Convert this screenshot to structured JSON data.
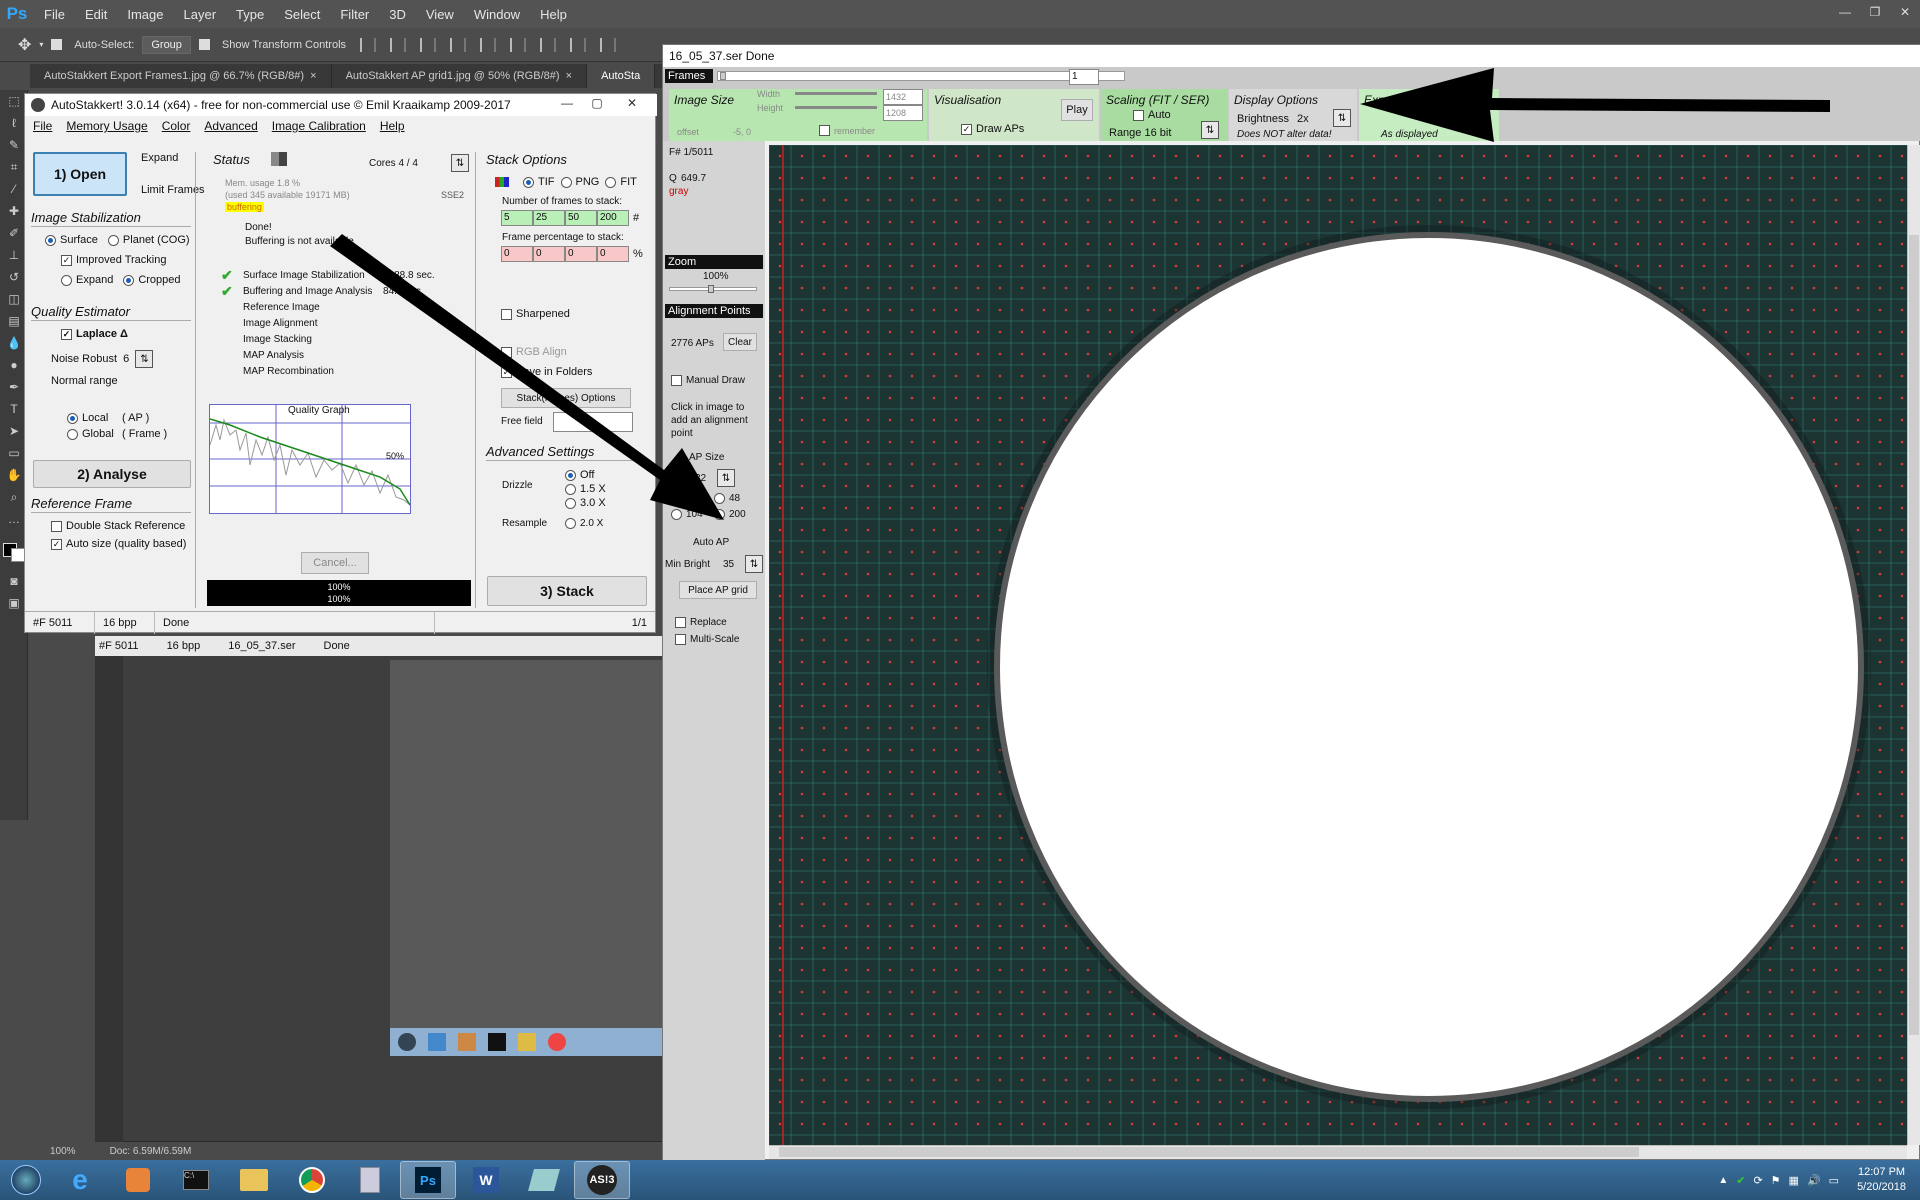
{
  "photoshop": {
    "logo": "Ps",
    "menus": [
      "File",
      "Edit",
      "Image",
      "Layer",
      "Type",
      "Select",
      "Filter",
      "3D",
      "View",
      "Window",
      "Help"
    ],
    "options": {
      "auto_select_label": "Auto-Select:",
      "group_value": "Group",
      "show_transform_label": "Show Transform Controls"
    },
    "tabs": [
      {
        "label": "AutoStakkert Export Frames1.jpg @ 66.7% (RGB/8#)",
        "close": "×"
      },
      {
        "label": "AutoStakkert AP grid1.jpg @ 50% (RGB/8#)",
        "close": "×"
      },
      {
        "label": "AutoSta"
      }
    ],
    "status": {
      "zoom": "100%",
      "doc": "Doc: 6.59M/6.59M"
    }
  },
  "ghost": {
    "frame": "#F 5011",
    "bpp": "16 bpp",
    "file": "16_05_37.ser",
    "state": "Done"
  },
  "as_main": {
    "title": "AutoStakkert! 3.0.14 (x64) - free for non-commercial use © Emil Kraaikamp 2009-2017",
    "menu": [
      "File",
      "Memory Usage",
      "Color",
      "Advanced",
      "Image Calibration",
      "Help"
    ],
    "open_button": "1) Open",
    "expand_label": "Expand",
    "limit_frames_label": "Limit Frames",
    "stabilization": {
      "title": "Image Stabilization",
      "surface": "Surface",
      "planet": "Planet (COG)",
      "improved_tracking": "Improved Tracking",
      "expand": "Expand",
      "cropped": "Cropped"
    },
    "quality": {
      "title": "Quality Estimator",
      "laplace": "Laplace Δ",
      "noise_robust_label": "Noise Robust",
      "noise_robust_value": "6",
      "normal_range": "Normal range",
      "local": "Local",
      "local_ap": "( AP )",
      "global": "Global",
      "global_frame": "( Frame )"
    },
    "analyse_button": "2) Analyse",
    "reference": {
      "title": "Reference Frame",
      "double_stack": "Double Stack Reference",
      "auto_size": "Auto size (quality based)"
    },
    "status": {
      "title": "Status",
      "cores": "Cores 4 / 4",
      "mem_usage": "Mem. usage 1.8 %",
      "mem_detail": "(used 345 available 19171 MB)",
      "sse": "SSE2",
      "buffering": "buffering",
      "done": "Done!",
      "buffering_na": "Buffering is not available",
      "steps": [
        {
          "label": "Surface Image Stabilization",
          "value": "1288.8 sec.",
          "checked": true
        },
        {
          "label": "Buffering and Image Analysis",
          "value": "84.0 sec.",
          "checked": true
        },
        {
          "label": "Reference Image",
          "value": "",
          "checked": false
        },
        {
          "label": "Image Alignment",
          "value": "",
          "checked": false
        },
        {
          "label": "Image Stacking",
          "value": "",
          "checked": false
        },
        {
          "label": "MAP Analysis",
          "value": "",
          "checked": false
        },
        {
          "label": "MAP Recombination",
          "value": "",
          "checked": false
        }
      ],
      "graph_title": "Quality Graph",
      "graph_pct": "50%",
      "cancel": "Cancel...",
      "progress1": "100%",
      "progress2": "100%"
    },
    "stack": {
      "title": "Stack Options",
      "formats": [
        "TIF",
        "PNG",
        "FIT"
      ],
      "frames_label": "Number of frames to stack:",
      "frames": [
        "5",
        "25",
        "50",
        "200"
      ],
      "frames_unit": "#",
      "pct_label": "Frame percentage to stack:",
      "pcts": [
        "0",
        "0",
        "0",
        "0"
      ],
      "pct_unit": "%",
      "sharpened": "Sharpened",
      "rgb_align": "RGB Align",
      "save_in_folders": "Save in Folders",
      "stack_names_button": "Stack(names) Options",
      "free_field_label": "Free field"
    },
    "advanced": {
      "title": "Advanced Settings",
      "drizzle_label": "Drizzle",
      "drizzle": [
        "Off",
        "1.5 X",
        "3.0 X"
      ],
      "resample_label": "Resample",
      "resample": "2.0 X"
    },
    "stack_button": "3) Stack",
    "statusbar": {
      "frame": "#F 5011",
      "bpp": "16 bpp",
      "file": "16_05_37.ser",
      "state": "Done",
      "page": "1/1"
    }
  },
  "img_win": {
    "title": "16_05_37.ser  Done",
    "frames_label": "Frames",
    "frame_input": "1",
    "size": {
      "title": "Image Size",
      "width_label": "Width",
      "width_value": "1432",
      "height_label": "Height",
      "height_value": "1208",
      "offset_label": "offset",
      "offset_value": "-5, 0",
      "remember": "remember"
    },
    "vis": {
      "title": "Visualisation",
      "draw_aps": "Draw APs",
      "play": "Play"
    },
    "scaling": {
      "title": "Scaling (FIT / SER)",
      "auto": "Auto",
      "range": "Range 16 bit"
    },
    "display": {
      "title": "Display Options",
      "brightness_label": "Brightness",
      "brightness_value": "2x",
      "note": "Does NOT alter data!"
    },
    "export": {
      "title": "Export Frame(s)",
      "as_displayed": "As displayed"
    },
    "left": {
      "frame_info": "F# 1/5011",
      "q_label": "Q",
      "q_value": "649.7",
      "gray": "gray",
      "zoom_header": "Zoom",
      "zoom_value": "100%",
      "ap_header": "Alignment Points",
      "ap_count": "2776 APs",
      "clear": "Clear",
      "manual_draw": "Manual Draw",
      "hint": "Click in image to add an alignment point",
      "ap_size_label": "AP Size",
      "ap_size_value": "32",
      "sizes": [
        "24",
        "48",
        "104",
        "200"
      ],
      "auto_ap": "Auto AP",
      "min_bright_label": "Min Bright",
      "min_bright_value": "35",
      "place_grid": "Place AP grid",
      "replace": "Replace",
      "multi_scale": "Multi-Scale"
    }
  },
  "taskbar": {
    "time": "12:07 PM",
    "date": "5/20/2018"
  }
}
